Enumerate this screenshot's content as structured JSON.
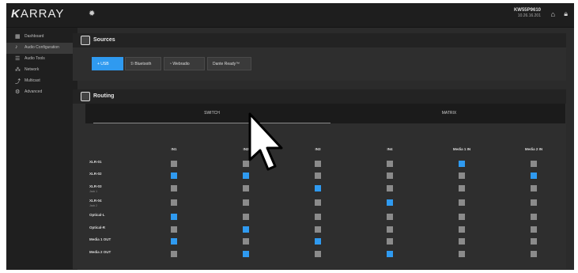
{
  "app": {
    "logo_k": "K",
    "logo_text": "ARRAY",
    "device_name": "KW55P9610",
    "device_ip": "10.26.16.201"
  },
  "sidebar": {
    "items": [
      {
        "label": "Dashboard",
        "icon": "dashboard-icon",
        "glyph": "▦",
        "active": false
      },
      {
        "label": "Audio Configuration",
        "icon": "audio-config-icon",
        "glyph": "♪",
        "active": true
      },
      {
        "label": "Audio Tools",
        "icon": "audio-tools-icon",
        "glyph": "☰",
        "active": false
      },
      {
        "label": "Network",
        "icon": "network-icon",
        "glyph": "⁂",
        "active": false
      },
      {
        "label": "Multicast",
        "icon": "multicast-icon",
        "glyph": "⤴",
        "active": false
      },
      {
        "label": "Advanced",
        "icon": "advanced-icon",
        "glyph": "⚙",
        "active": false
      }
    ]
  },
  "sources": {
    "title": "Sources",
    "buttons": [
      {
        "label": "+ USB",
        "active": true
      },
      {
        "label": "ℬ Bluetooth",
        "active": false
      },
      {
        "label": "◔ Webradio",
        "active": false
      },
      {
        "label": "Dante Ready™",
        "active": false
      }
    ]
  },
  "routing": {
    "title": "Routing",
    "tabs": [
      {
        "label": "SWITCH",
        "active": true
      },
      {
        "label": "MATRIX",
        "active": false
      }
    ],
    "columns": [
      "IN1",
      "IN2",
      "IN3",
      "IN4",
      "Media 1 IN",
      "Media 2 IN"
    ],
    "rows": [
      {
        "label": "XLR-01",
        "sub": "",
        "on": [
          false,
          false,
          false,
          false,
          true,
          false
        ]
      },
      {
        "label": "XLR-02",
        "sub": "",
        "on": [
          true,
          true,
          false,
          false,
          false,
          true
        ]
      },
      {
        "label": "XLR-03",
        "sub": "Jack 1",
        "on": [
          false,
          false,
          true,
          false,
          false,
          false
        ]
      },
      {
        "label": "XLR-04",
        "sub": "Jack 2",
        "on": [
          false,
          false,
          false,
          true,
          false,
          false
        ]
      },
      {
        "label": "Optical-L",
        "sub": "",
        "on": [
          true,
          false,
          false,
          false,
          false,
          false
        ]
      },
      {
        "label": "Optical-R",
        "sub": "",
        "on": [
          false,
          true,
          false,
          false,
          false,
          false
        ]
      },
      {
        "label": "Media 1 OUT",
        "sub": "",
        "on": [
          true,
          false,
          true,
          false,
          false,
          false
        ]
      },
      {
        "label": "Media 2 OUT",
        "sub": "",
        "on": [
          false,
          true,
          false,
          true,
          false,
          false
        ]
      }
    ]
  },
  "colors": {
    "accent": "#2f9af0",
    "inactive_cell": "#8b8b8b"
  }
}
